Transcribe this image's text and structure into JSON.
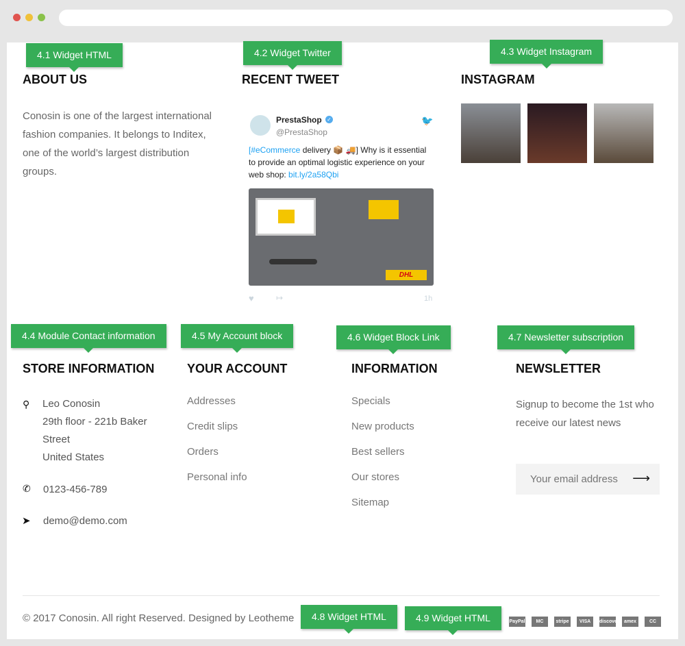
{
  "tags": [
    "4.1 Widget HTML",
    "4.2 Widget Twitter",
    "4.3 Widget Instagram",
    "4.4 Module Contact information",
    "4.5 My Account block",
    "4.6 Widget Block Link",
    "4.7 Newsletter subscription",
    "4.8 Widget HTML",
    "4.9 Widget HTML"
  ],
  "about": {
    "title": "ABOUT US",
    "text": "Conosin is one of the largest international fashion companies. It belongs to Inditex, one of the world’s largest distribution groups."
  },
  "tweet": {
    "title": "RECENT TWEET",
    "name": "PrestaShop",
    "handle": "@PrestaShop",
    "hashtag": "[#eCommerce",
    "text1": " delivery 📦 🚚] Why is it essential to provide an optimal logistic experience on your web shop: ",
    "link": "bit.ly/2a58Qbi",
    "time": "1h",
    "image_logo": "DHL"
  },
  "instagram": {
    "title": "INSTAGRAM"
  },
  "store": {
    "title": "STORE INFORMATION",
    "address": [
      "Leo Conosin",
      "29th floor - 221b Baker",
      "Street",
      "United States"
    ],
    "phone": "0123-456-789",
    "email": "demo@demo.com"
  },
  "account": {
    "title": "YOUR ACCOUNT",
    "items": [
      "Addresses",
      "Credit slips",
      "Orders",
      "Personal info"
    ]
  },
  "information": {
    "title": "INFORMATION",
    "items": [
      "Specials",
      "New products",
      "Best sellers",
      "Our stores",
      "Sitemap"
    ]
  },
  "newsletter": {
    "title": "NEWSLETTER",
    "text": "Signup to become the 1st who receive our latest news",
    "placeholder": "Your email address"
  },
  "footer": {
    "copyright": "© 2017 Conosin. All right Reserved. Designed by Leotheme",
    "payments": [
      "PayPal",
      "MC",
      "stripe",
      "VISA",
      "discover",
      "amex",
      "CC"
    ]
  },
  "colors": {
    "tag": "#36ad57",
    "link": "#1da1f2"
  }
}
